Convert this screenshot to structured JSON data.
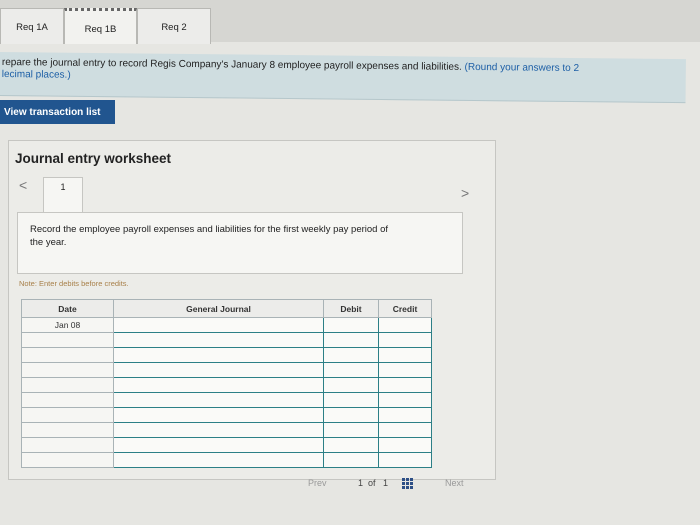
{
  "tabs": [
    {
      "label": "Req 1A"
    },
    {
      "label": "Req 1B"
    },
    {
      "label": "Req 2"
    }
  ],
  "instructions": {
    "text": "repare the journal entry to record Regis Company's January 8 employee payroll expenses and liabilities.",
    "note_line1": "(Round your answers to 2",
    "note_line2": "lecimal places.)"
  },
  "view_transaction_button": "View transaction list",
  "worksheet": {
    "title": "Journal entry worksheet",
    "prev_arrow": "<",
    "next_arrow": ">",
    "step_number": "1",
    "step_text": "Record the employee payroll expenses and liabilities for the first weekly pay period of the year.",
    "note": "Note: Enter debits before credits."
  },
  "table": {
    "headers": {
      "date": "Date",
      "general_journal": "General Journal",
      "debit": "Debit",
      "credit": "Credit"
    },
    "rows": [
      {
        "date": "Jan 08"
      },
      {
        "date": ""
      },
      {
        "date": ""
      },
      {
        "date": ""
      },
      {
        "date": ""
      },
      {
        "date": ""
      },
      {
        "date": ""
      },
      {
        "date": ""
      },
      {
        "date": ""
      },
      {
        "date": ""
      }
    ]
  },
  "pager": {
    "prev": "Prev",
    "page": "1",
    "of": "of",
    "total": "1",
    "next": "Next"
  }
}
